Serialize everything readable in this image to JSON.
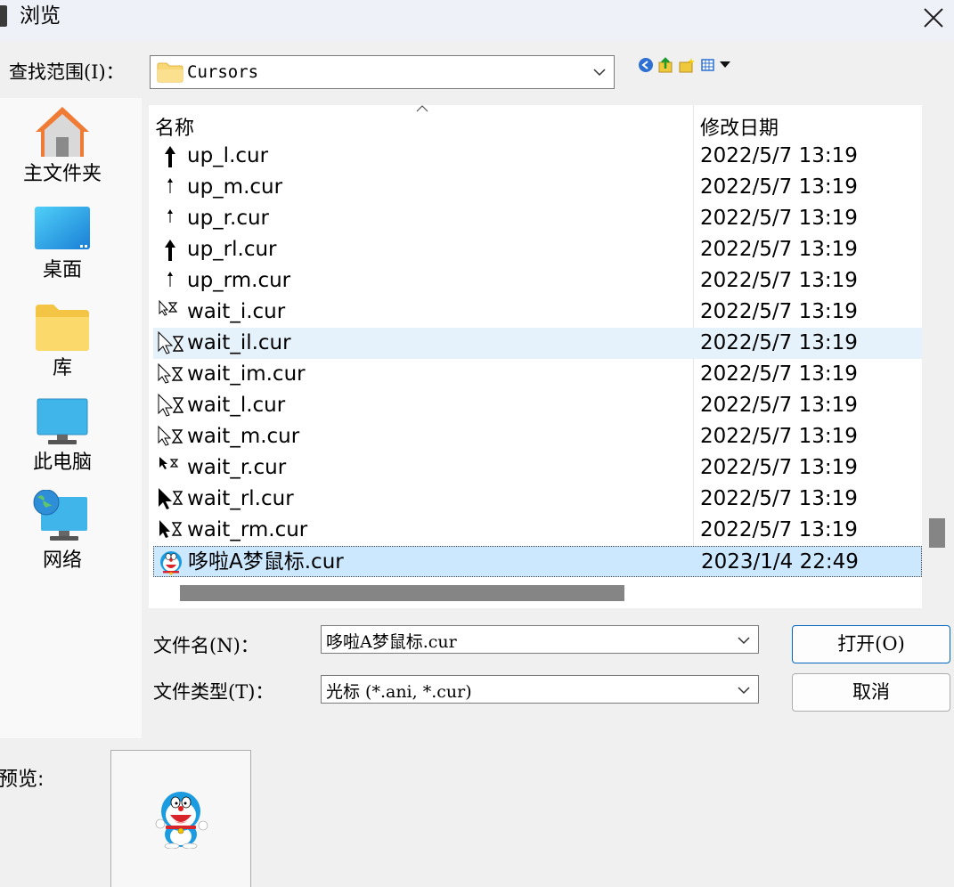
{
  "window": {
    "title": "浏览"
  },
  "lookin": {
    "label": "查找范围(I)：",
    "value": "Cursors"
  },
  "places": [
    {
      "name": "home",
      "label": "主文件夹"
    },
    {
      "name": "desktop",
      "label": "桌面"
    },
    {
      "name": "library",
      "label": "库"
    },
    {
      "name": "this-pc",
      "label": "此电脑"
    },
    {
      "name": "network",
      "label": "网络"
    }
  ],
  "filelist": {
    "headers": {
      "name": "名称",
      "date": "修改日期"
    },
    "rows": [
      {
        "name": "up_l.cur",
        "date": "2022/5/7 13:19",
        "icon": "arrow-up-bold-icon"
      },
      {
        "name": "up_m.cur",
        "date": "2022/5/7 13:19",
        "icon": "arrow-up-thin-icon"
      },
      {
        "name": "up_r.cur",
        "date": "2022/5/7 13:19",
        "icon": "arrow-up-thin-icon"
      },
      {
        "name": "up_rl.cur",
        "date": "2022/5/7 13:19",
        "icon": "arrow-up-bold-icon"
      },
      {
        "name": "up_rm.cur",
        "date": "2022/5/7 13:19",
        "icon": "arrow-up-thin-icon"
      },
      {
        "name": "wait_i.cur",
        "date": "2022/5/7 13:19",
        "icon": "busy-pointer-small-icon"
      },
      {
        "name": "wait_il.cur",
        "date": "2022/5/7 13:19",
        "icon": "busy-pointer-white-icon"
      },
      {
        "name": "wait_im.cur",
        "date": "2022/5/7 13:19",
        "icon": "busy-pointer-white-icon"
      },
      {
        "name": "wait_l.cur",
        "date": "2022/5/7 13:19",
        "icon": "busy-pointer-white-icon"
      },
      {
        "name": "wait_m.cur",
        "date": "2022/5/7 13:19",
        "icon": "busy-pointer-white-icon"
      },
      {
        "name": "wait_r.cur",
        "date": "2022/5/7 13:19",
        "icon": "busy-pointer-black-small-icon"
      },
      {
        "name": "wait_rl.cur",
        "date": "2022/5/7 13:19",
        "icon": "busy-pointer-black-icon"
      },
      {
        "name": "wait_rm.cur",
        "date": "2022/5/7 13:19",
        "icon": "busy-pointer-black-icon"
      },
      {
        "name": "哆啦A梦鼠标.cur",
        "date": "2023/1/4 22:49",
        "icon": "doraemon-cursor-icon"
      }
    ]
  },
  "filename": {
    "label": "文件名(N)：",
    "value": "哆啦A梦鼠标.cur"
  },
  "filetype": {
    "label": "文件类型(T)：",
    "value": "光标 (*.ani, *.cur)"
  },
  "buttons": {
    "open": "打开(O)",
    "cancel": "取消"
  },
  "preview": {
    "label": "预览:"
  },
  "colors": {
    "accent": "#0067c0",
    "selected_row": "#cce8ff",
    "hover_row": "#e5f1fb",
    "folder": "#f8d775"
  }
}
